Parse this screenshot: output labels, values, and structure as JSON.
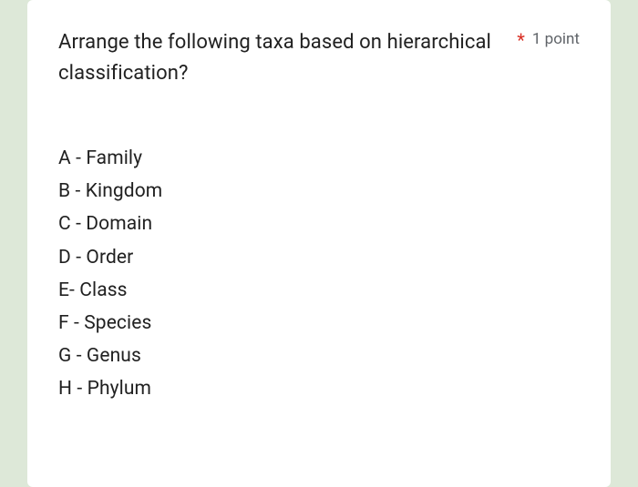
{
  "question": {
    "text": "Arrange the following taxa based on hierarchical classification?",
    "required_mark": "*",
    "points_label": "1 point"
  },
  "options": [
    "A - Family",
    "B - Kingdom",
    "C - Domain",
    "D - Order",
    "E- Class",
    "F - Species",
    "G - Genus",
    "H - Phylum"
  ]
}
